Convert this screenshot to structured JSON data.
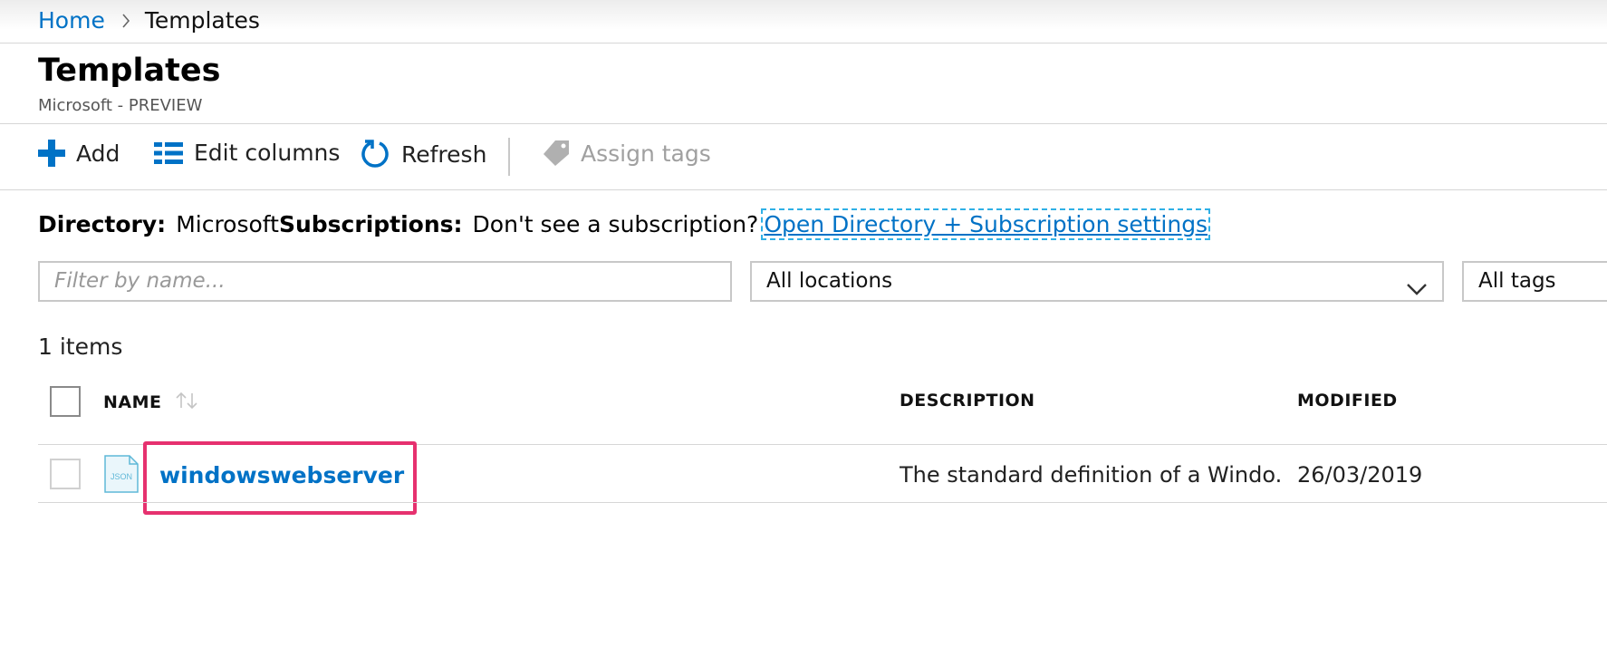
{
  "breadcrumb": {
    "home": "Home",
    "current": "Templates"
  },
  "header": {
    "title": "Templates",
    "subtitle": "Microsoft - PREVIEW"
  },
  "toolbar": {
    "add_label": "Add",
    "edit_columns_label": "Edit columns",
    "refresh_label": "Refresh",
    "assign_tags_label": "Assign tags"
  },
  "directory_row": {
    "directory_label": "Directory:",
    "directory_value": "Microsoft",
    "subscriptions_label": "Subscriptions:",
    "prompt_text": "Don't see a subscription?",
    "settings_link": "Open Directory + Subscription settings"
  },
  "filters": {
    "name_placeholder": "Filter by name...",
    "location_selected": "All locations",
    "tags_selected": "All tags"
  },
  "list": {
    "count_text": "1 items",
    "columns": {
      "name": "NAME",
      "description": "DESCRIPTION",
      "modified": "MODIFIED"
    },
    "rows": [
      {
        "icon_label": "JSON",
        "name": "windowswebserver",
        "description": "The standard definition of a Windo...",
        "modified": "26/03/2019"
      }
    ]
  },
  "colors": {
    "link_blue": "#0072c6",
    "highlight_pink": "#e6316f",
    "dashed_focus": "#2fb0e6"
  }
}
